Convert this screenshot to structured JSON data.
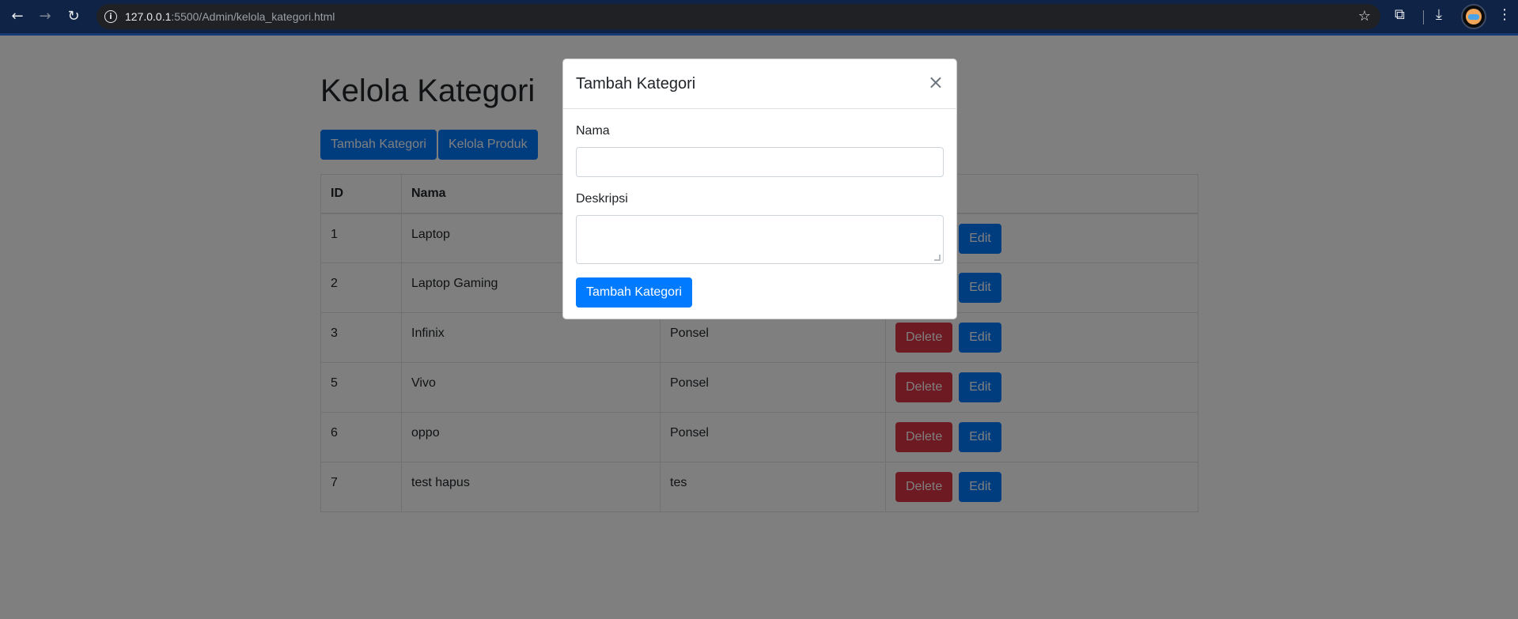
{
  "browser": {
    "url_host": "127.0.0.1",
    "url_rest": ":5500/Admin/kelola_kategori.html"
  },
  "page": {
    "title": "Kelola Kategori",
    "buttons": {
      "add_category": "Tambah Kategori",
      "manage_products": "Kelola Produk"
    },
    "table": {
      "headers": [
        "ID",
        "Nama",
        "",
        ""
      ],
      "rows": [
        {
          "id": "1",
          "nama": "Laptop",
          "deskripsi": ""
        },
        {
          "id": "2",
          "nama": "Laptop Gaming",
          "deskripsi": ""
        },
        {
          "id": "3",
          "nama": "Infinix",
          "deskripsi": "Ponsel"
        },
        {
          "id": "5",
          "nama": "Vivo",
          "deskripsi": "Ponsel"
        },
        {
          "id": "6",
          "nama": "oppo",
          "deskripsi": "Ponsel"
        },
        {
          "id": "7",
          "nama": "test hapus",
          "deskripsi": "tes"
        }
      ],
      "delete_label": "Delete",
      "edit_label": "Edit"
    }
  },
  "modal": {
    "title": "Tambah Kategori",
    "close_symbol": "×",
    "fields": {
      "nama_label": "Nama",
      "nama_value": "",
      "deskripsi_label": "Deskripsi",
      "deskripsi_value": ""
    },
    "submit_label": "Tambah Kategori"
  },
  "colors": {
    "primary": "#007bff",
    "danger": "#dc3545",
    "browser_bar": "#0f2346",
    "backdrop": "rgba(0,0,0,0.5)"
  }
}
